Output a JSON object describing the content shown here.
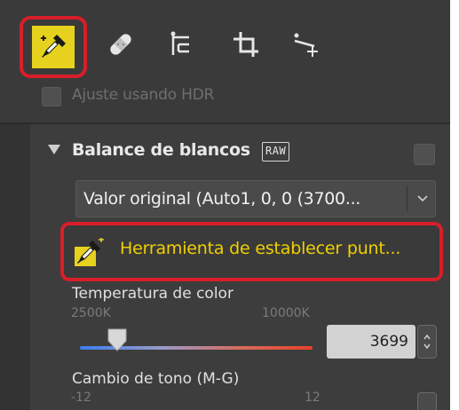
{
  "toolbar": {
    "tools": [
      {
        "name": "white-balance-eyedropper",
        "icon": "eyedropper-icon",
        "active": true
      },
      {
        "name": "retouch-brush",
        "icon": "bandage-icon"
      },
      {
        "name": "level-adjust",
        "icon": "levels-icon"
      },
      {
        "name": "crop",
        "icon": "crop-icon"
      },
      {
        "name": "straighten",
        "icon": "straighten-icon"
      }
    ]
  },
  "hdr": {
    "label": "Ajuste usando HDR",
    "checked": false
  },
  "white_balance": {
    "title": "Balance de blancos",
    "badge": "RAW",
    "checked": false,
    "dropdown_value": "Valor original (Auto1, 0, 0 (3700...",
    "tool_button_label": "Herramienta de establecer punt...",
    "temperature": {
      "label": "Temperatura de color",
      "min_label": "2500K",
      "max_label": "10000K",
      "value": "3699",
      "value_number": 3699,
      "min": 2500,
      "max": 10000
    },
    "tint": {
      "label": "Cambio de tono (M-G)",
      "min_label": "-12",
      "max_label": "12"
    }
  },
  "colors": {
    "highlight": "#d81e2a",
    "tool_accent": "#f0d000",
    "panel_bg": "#3a3a3a"
  }
}
